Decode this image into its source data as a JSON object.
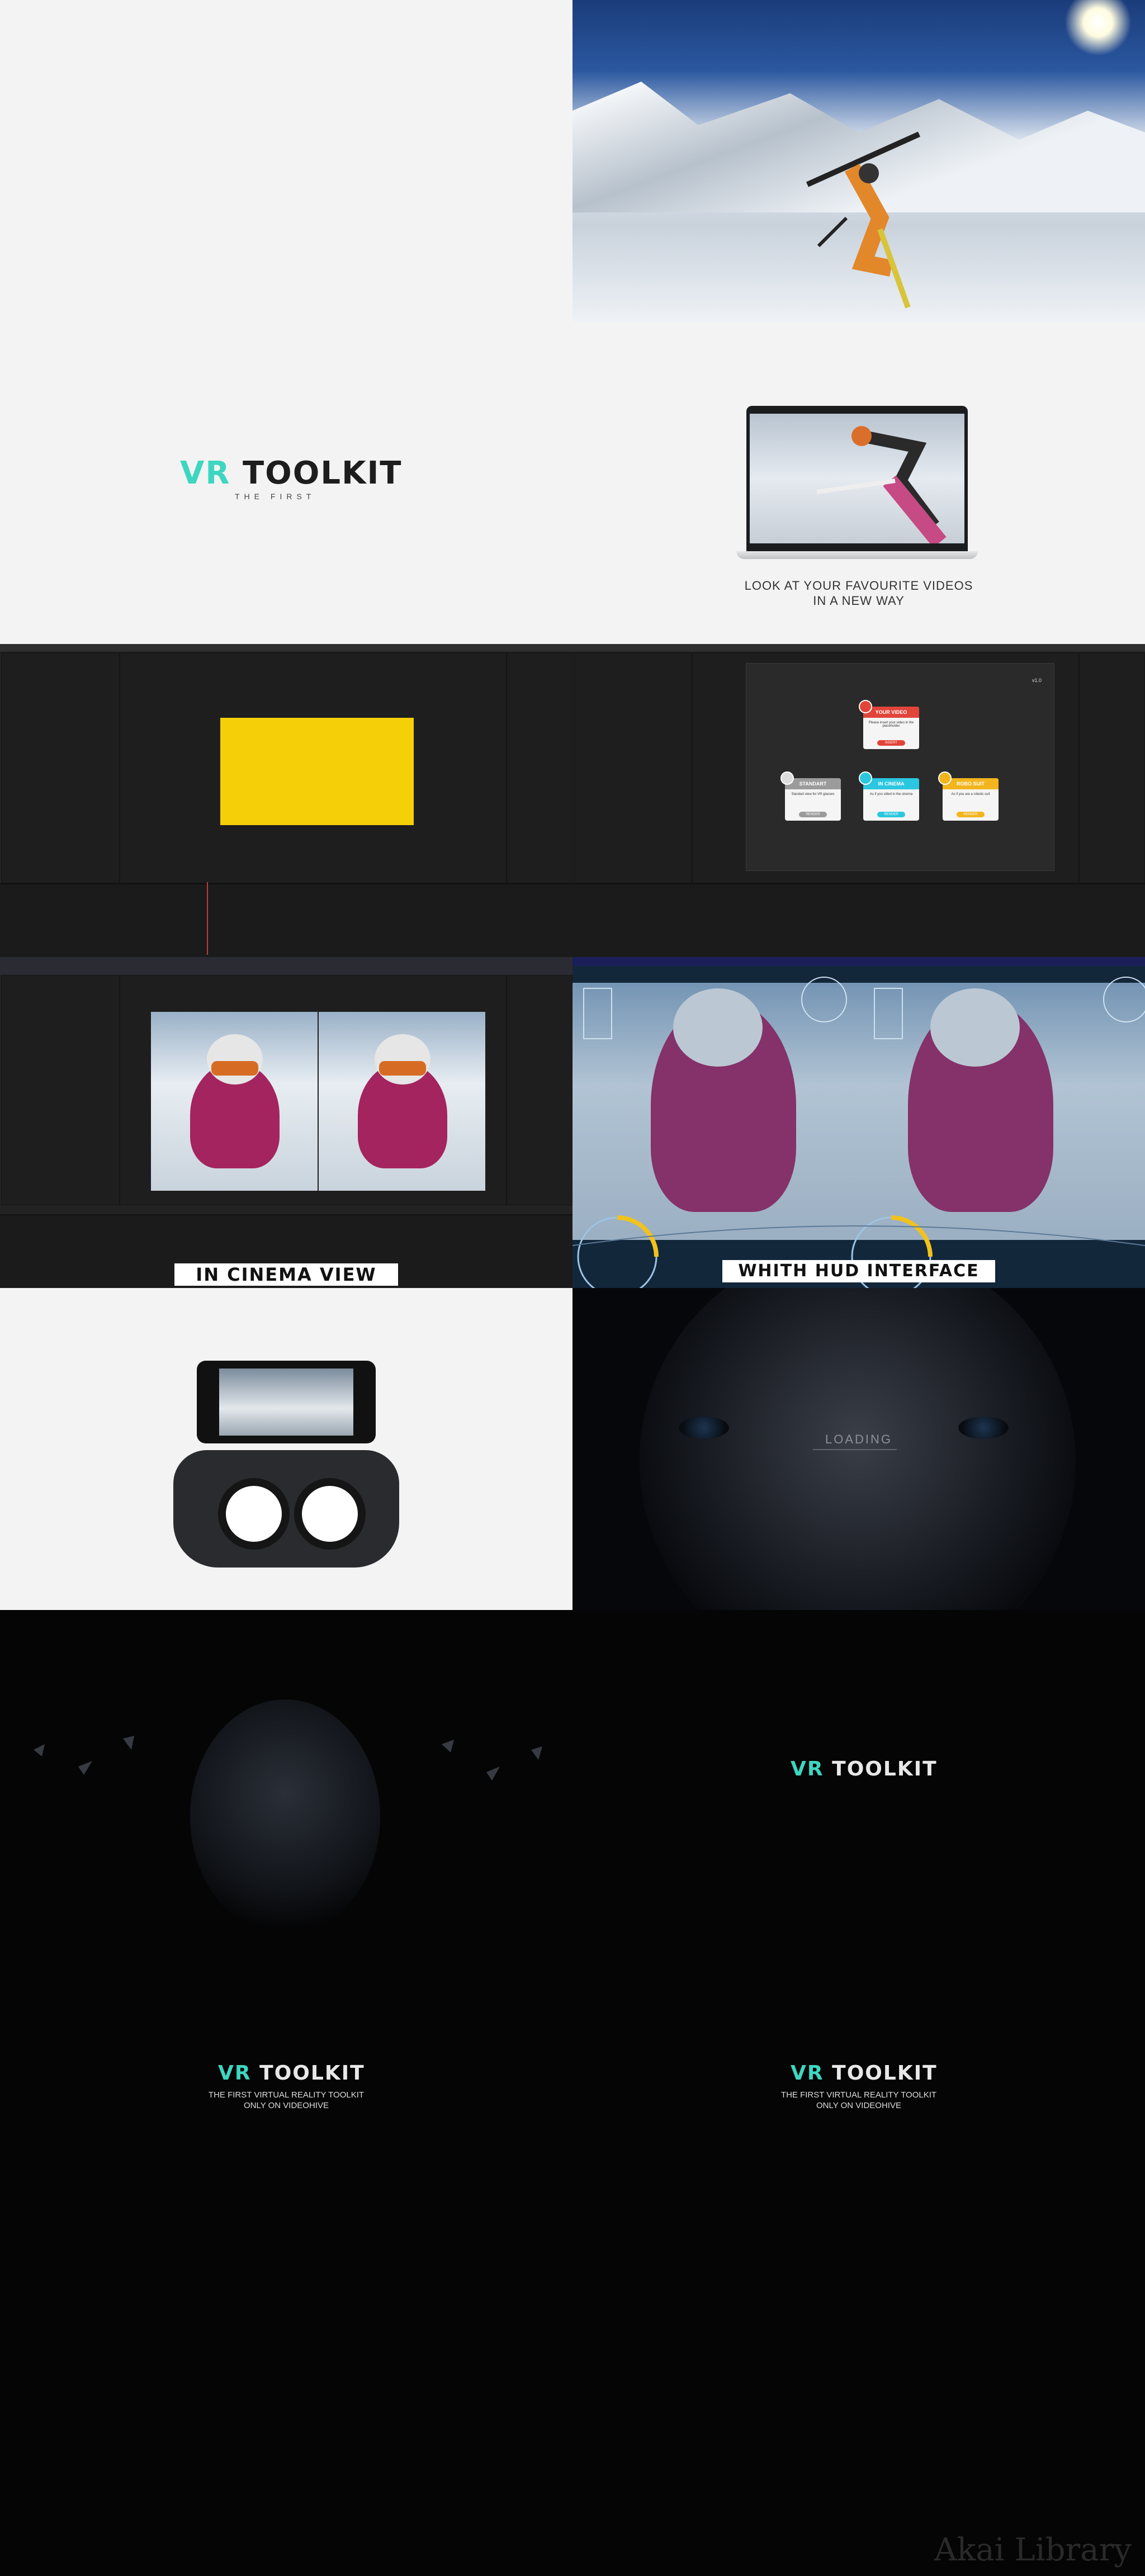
{
  "tiles": {
    "tagline": "LOOK AT YOUR FAVOURITE VIDEOS\nIN A NEW WAY",
    "logo_vr": "VR",
    "logo_toolkit": "TOOLKIT",
    "logo_sub": "THE FIRST",
    "cinema_label": "IN CINEMA VIEW",
    "hud_label": "WHITH HUD INTERFACE",
    "loading": "LOADING",
    "final_sub": "THE FIRST VIRTUAL REALITY TOOLKIT\nONLY ON VIDEOHIVE",
    "watermark": "Akai Library"
  },
  "ae_cards": {
    "version": "v1.0",
    "your_video": {
      "title": "YOUR VIDEO",
      "body": "Please insert your video in the placeholder",
      "button": "INSERT"
    },
    "standart": {
      "title": "STANDART",
      "body": "Standart view for VR glasses",
      "button": "RENDER"
    },
    "in_cinema": {
      "title": "IN CINEMA",
      "body": "As if you sitted in the cinema",
      "button": "RENDER"
    },
    "robo_suit": {
      "title": "ROBO SUIT",
      "body": "As if you are a robotic suit",
      "button": "RENDER"
    }
  },
  "colors": {
    "accent": "#3dd6c0",
    "red": "#e1453a",
    "grey": "#9b9b9b",
    "cyan": "#2bc7e0",
    "yellow": "#f2b51d",
    "comp_yellow": "#f5d008"
  }
}
